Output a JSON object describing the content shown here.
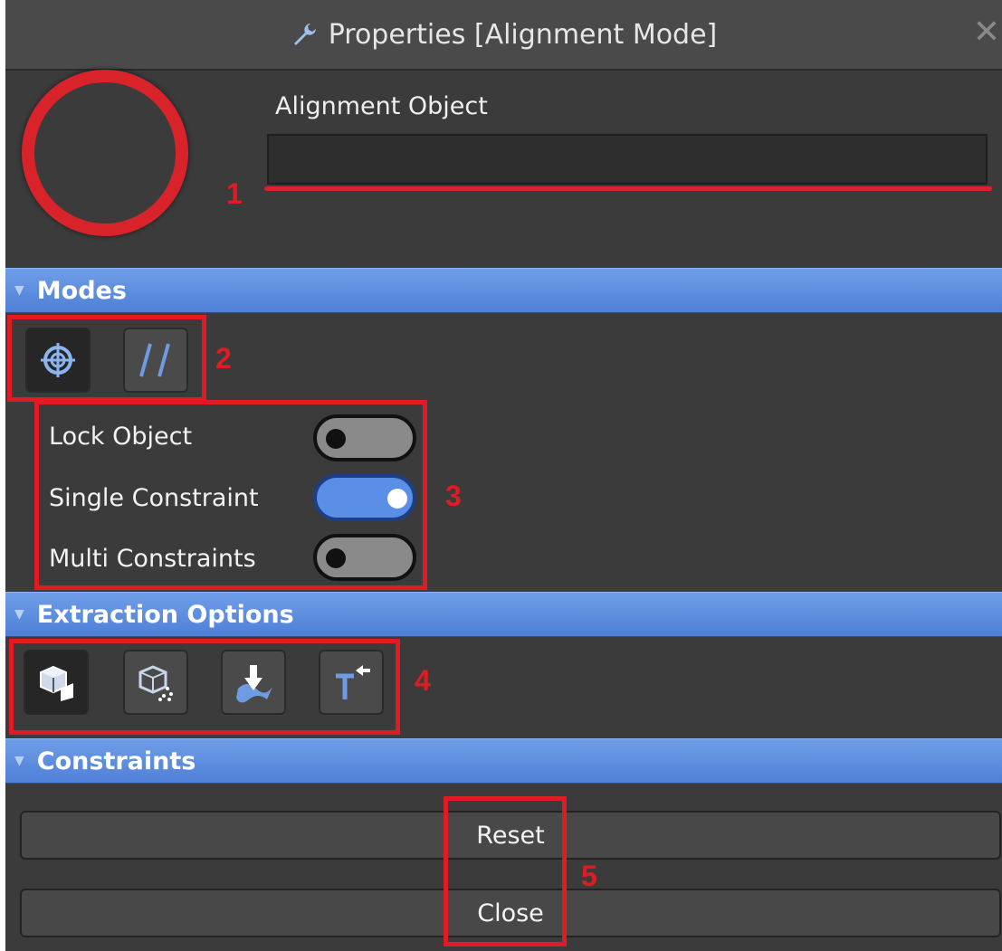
{
  "window": {
    "title": "Properties [Alignment Mode]",
    "close_label": "✕"
  },
  "object": {
    "label": "Alignment Object",
    "value": ""
  },
  "sections": {
    "modes": "Modes",
    "extraction": "Extraction Options",
    "constraints": "Constraints"
  },
  "modes": {
    "buttons": [
      {
        "icon": "crosshair-icon",
        "active": true
      },
      {
        "icon": "parallel-lines-icon",
        "active": false
      }
    ]
  },
  "toggles": [
    {
      "label": "Lock Object",
      "on": false
    },
    {
      "label": "Single Constraint",
      "on": true
    },
    {
      "label": "Multi Constraints",
      "on": false
    }
  ],
  "extraction": {
    "buttons": [
      {
        "icon": "cube-face-icon",
        "active": true
      },
      {
        "icon": "cube-points-icon",
        "active": false
      },
      {
        "icon": "surface-extract-icon",
        "active": false
      },
      {
        "icon": "edge-extract-icon",
        "active": false
      }
    ]
  },
  "buttons": {
    "reset": "Reset",
    "close": "Close"
  },
  "annotations": [
    "1",
    "2",
    "3",
    "4",
    "5"
  ],
  "colors": {
    "accent": "#d8232a",
    "section": "#5b8fe6",
    "panel": "#3b3b3b"
  }
}
